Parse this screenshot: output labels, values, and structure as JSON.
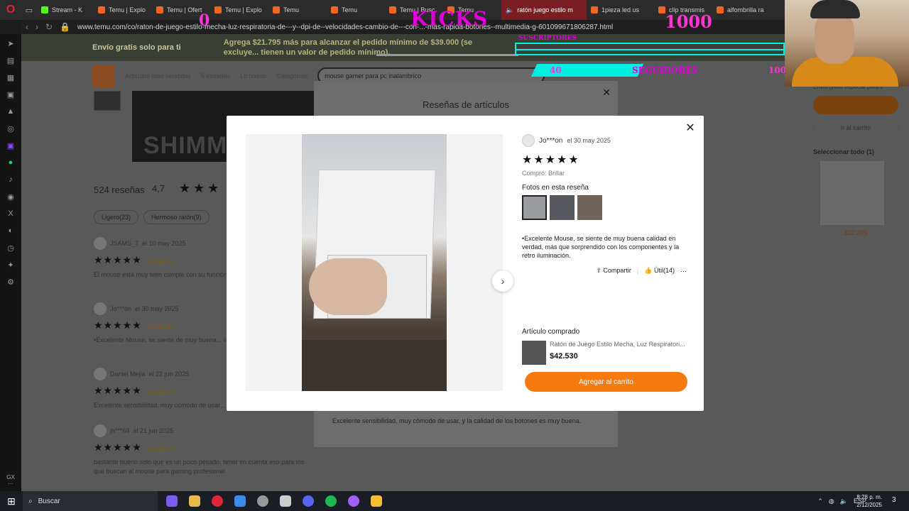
{
  "browser": {
    "tabs": [
      {
        "label": "Stream - K",
        "icon": "kick-icon",
        "active": false
      },
      {
        "label": "Temu | Explo",
        "icon": "temu-icon",
        "active": false
      },
      {
        "label": "Temu | Ofert",
        "icon": "temu-icon",
        "active": false
      },
      {
        "label": "Temu | Explo",
        "icon": "temu-icon",
        "active": false
      },
      {
        "label": "Temu",
        "icon": "temu-icon",
        "active": false
      },
      {
        "label": "Temu",
        "icon": "temu-icon",
        "active": false
      },
      {
        "label": "Temu | Busc",
        "icon": "temu-icon",
        "active": false
      },
      {
        "label": "Temu",
        "icon": "temu-icon",
        "active": false
      },
      {
        "label": "ratón juego estilo m",
        "icon": "speaker-icon",
        "active": true
      },
      {
        "label": "1pieza led us",
        "icon": "temu-icon",
        "active": false
      },
      {
        "label": "clip transmis",
        "icon": "temu-icon",
        "active": false
      },
      {
        "label": "alfombrilla ra",
        "icon": "temu-icon",
        "active": false
      }
    ],
    "url": "www.temu.com/co/raton-de-juego-estilo-mecha-luz-respiratoria-de---y--dpi-de--velocidades-cambio-de---con-...-mas-rapida-botones--multimedia-g-601099671806287.html"
  },
  "page": {
    "promo_free_shipping": "Envío gratis solo para ti",
    "promo_add": "Agrega $21.795 más para alcanzar el pedido mínimo de $39.000 (se excluye... tienen un valor de pedido mínimo).",
    "nav": {
      "best_sellers": "Artículos más vendidos",
      "five_stars": "5 estrellas",
      "new": "Lo nuevo",
      "categories": "Categorías",
      "search_value": "mouse gamer para pc inalambrico"
    },
    "banner_text": "SHIMMER",
    "reviews_count": "524 reseñas",
    "rating": "4,7",
    "chips": [
      "Ligero(23)",
      "Hermoso ratón(9)"
    ],
    "reviews": [
      {
        "name": "JSAMS_7",
        "date": "el 10 may 2025",
        "tag": "Excelente",
        "text": "El mouse está muy bien cumple con su función... de 10 muy recomendado"
      },
      {
        "name": "Jo***on",
        "date": "el 30 may 2025",
        "tag": "Excelente",
        "text": "•Excelente Mouse, se siente de muy buena... la retro iluminación."
      },
      {
        "name": "Daniel Mejia",
        "date": "el 22 jun 2025",
        "tag": "Excelente",
        "text": "Excelente sensibilidad, muy cómodo de usar..."
      },
      {
        "name": "jh***69",
        "date": "el 21 jun 2025",
        "tag": "Excelente",
        "text": "bastante bueno solo que es un poco pesado, tener en cuenta eso para los que buscan al mouse para gaming profesional"
      }
    ],
    "right": {
      "free_ship_note": "Envío gratis especial para ti",
      "cart_button": "Ir al carrito",
      "select_all": "Seleccionar todo (1)",
      "price": "$37.205"
    },
    "back_dialog_title": "Reseñas de artículos",
    "back_dialog_bottom": "Excelente sensibilidad, muy cómodo de usar, y la calidad de los botones es muy buena."
  },
  "modal": {
    "reviewer": "Jo***on",
    "date": "el 30 may 2025",
    "stars": "★★★★★",
    "bought_variant": "Compró: Brillar",
    "photos_label": "Fotos en esta reseña",
    "review_text": "•Excelente Mouse, se siente de muy buena calidad en verdad, más que sorprendido con los componentes y la retro iluminación.",
    "share": "Compartir",
    "useful": "Útil(14)",
    "more": "···",
    "bought_title": "Artículo comprado",
    "product_name": "Ratón de Juego Estilo Mecha, Luz Respiratori...",
    "product_price": "$42.530",
    "add_to_cart": "Agregar al carrito",
    "next": "›",
    "close": "✕"
  },
  "overlay": {
    "kicks_label": "KICKS",
    "kicks_current": "0",
    "kicks_goal": "1000",
    "subs_label": "SUSCRIPTORES",
    "followers_label": "SEGUIDORES",
    "followers_current": "40",
    "followers_goal": "100"
  },
  "taskbar": {
    "search": "Buscar",
    "lang": "ESP",
    "time": "8:28 p. m.",
    "date": "2/12/2025",
    "notif_count": "3"
  },
  "colors": {
    "accent_orange": "#f57a10",
    "overlay_magenta": "#e100d8",
    "overlay_cyan": "#00f0e0"
  }
}
